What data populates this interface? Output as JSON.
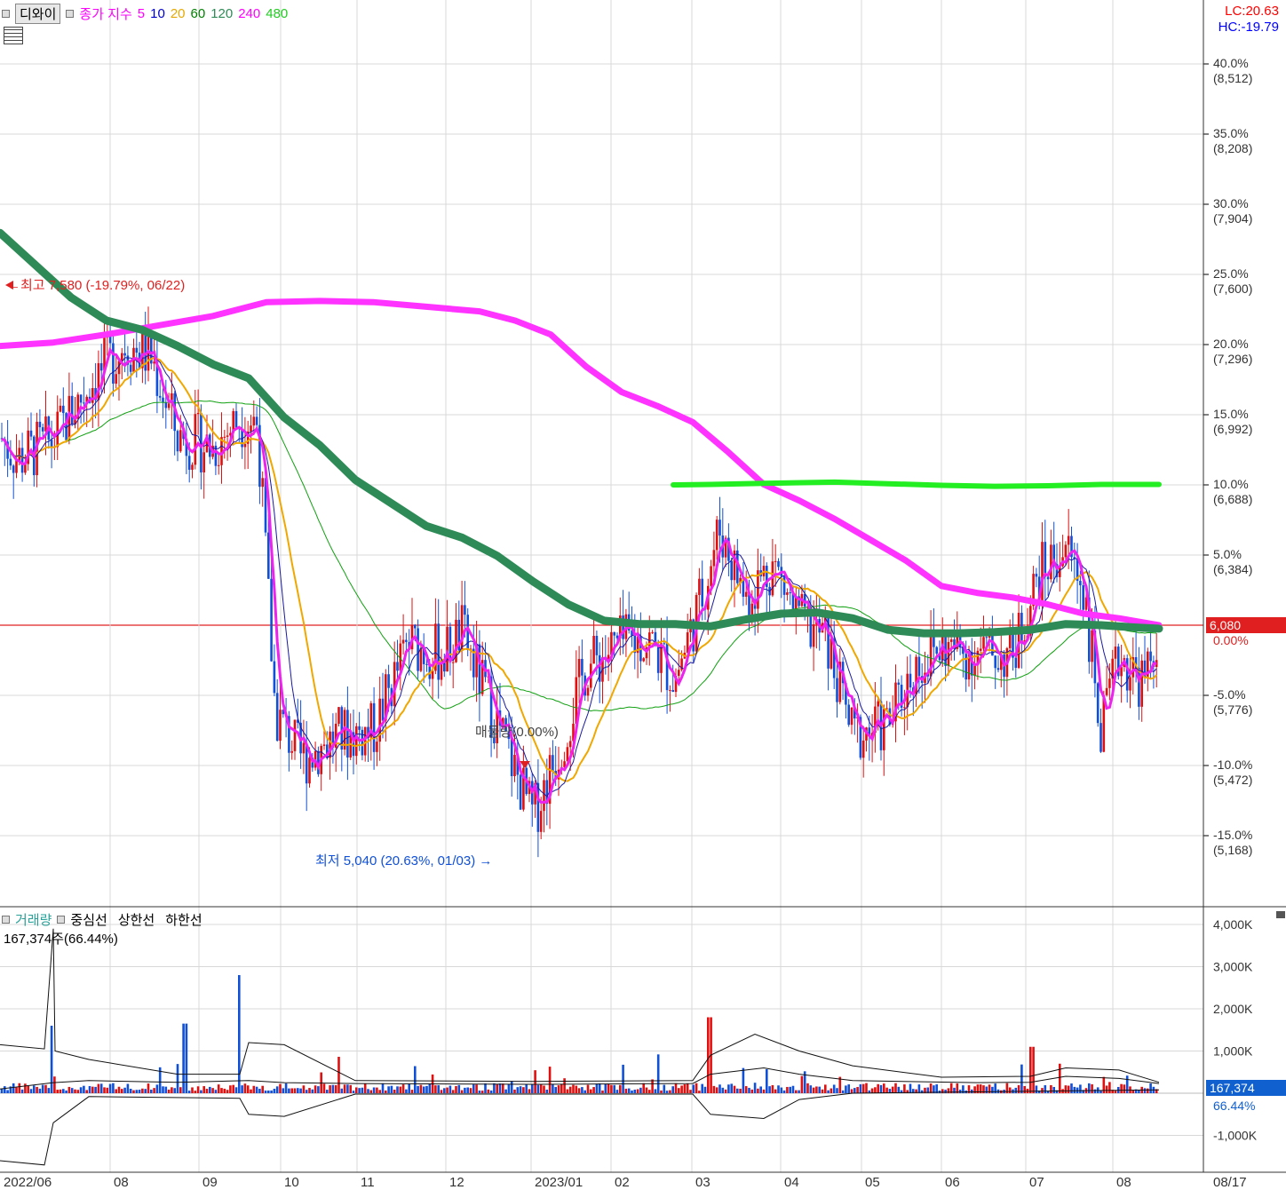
{
  "chart_data": [
    {
      "type": "line",
      "symbol": "디와이",
      "legend": {
        "title": "종가 지수",
        "periods": [
          {
            "label": "5",
            "color": "#ff00ff"
          },
          {
            "label": "10",
            "color": "#0000cc"
          },
          {
            "label": "20",
            "color": "#e6a800"
          },
          {
            "label": "60",
            "color": "#008000"
          },
          {
            "label": "120",
            "color": "#2e8b57"
          },
          {
            "label": "240",
            "color": "#ff00ff"
          },
          {
            "label": "480",
            "color": "#22cc22"
          }
        ]
      },
      "lc_label": "LC:20.63",
      "hc_label": "HC:-19.79",
      "current_price": 6080,
      "current_price_label": "6,080",
      "current_pct_label": "0.00%",
      "y_ticks": [
        {
          "pct": "40.0%",
          "price": "(8,512)",
          "value": 8512
        },
        {
          "pct": "35.0%",
          "price": "(8,208)",
          "value": 8208
        },
        {
          "pct": "30.0%",
          "price": "(7,904)",
          "value": 7904
        },
        {
          "pct": "25.0%",
          "price": "(7,600)",
          "value": 7600
        },
        {
          "pct": "20.0%",
          "price": "(7,296)",
          "value": 7296
        },
        {
          "pct": "15.0%",
          "price": "(6,992)",
          "value": 6992
        },
        {
          "pct": "10.0%",
          "price": "(6,688)",
          "value": 6688
        },
        {
          "pct": "5.0%",
          "price": "(6,384)",
          "value": 6384
        },
        {
          "pct": "-5.0%",
          "price": "(5,776)",
          "value": 5776
        },
        {
          "pct": "-10.0%",
          "price": "(5,472)",
          "value": 5472
        },
        {
          "pct": "-15.0%",
          "price": "(5,168)",
          "value": 5168
        }
      ],
      "annotations": [
        {
          "text": "최고 7,580 (-19.79%, 06/22)",
          "value": 7580
        },
        {
          "text": "최저 5,040 (20.63%, 01/03)",
          "value": 5040
        },
        {
          "text": "매물량(0.00%)"
        }
      ],
      "ma_series": [
        {
          "name": "240",
          "color": "#ff33ff",
          "points": [
            [
              0,
              7290
            ],
            [
              60,
              7305
            ],
            [
              120,
              7340
            ],
            [
              180,
              7380
            ],
            [
              240,
              7420
            ],
            [
              300,
              7480
            ],
            [
              360,
              7485
            ],
            [
              420,
              7480
            ],
            [
              480,
              7460
            ],
            [
              540,
              7440
            ],
            [
              580,
              7400
            ],
            [
              620,
              7340
            ],
            [
              660,
              7200
            ],
            [
              700,
              7090
            ],
            [
              740,
              7030
            ],
            [
              780,
              6960
            ],
            [
              820,
              6830
            ],
            [
              860,
              6690
            ],
            [
              900,
              6620
            ],
            [
              940,
              6540
            ],
            [
              980,
              6450
            ],
            [
              1020,
              6360
            ],
            [
              1060,
              6250
            ],
            [
              1100,
              6220
            ],
            [
              1140,
              6200
            ],
            [
              1180,
              6170
            ],
            [
              1220,
              6130
            ],
            [
              1260,
              6110
            ],
            [
              1305,
              6080
            ]
          ]
        },
        {
          "name": "120",
          "color": "#2e8b57",
          "points": [
            [
              0,
              7780
            ],
            [
              40,
              7640
            ],
            [
              80,
              7500
            ],
            [
              120,
              7400
            ],
            [
              160,
              7360
            ],
            [
              200,
              7290
            ],
            [
              240,
              7210
            ],
            [
              280,
              7150
            ],
            [
              320,
              6980
            ],
            [
              360,
              6860
            ],
            [
              400,
              6710
            ],
            [
              440,
              6610
            ],
            [
              480,
              6510
            ],
            [
              520,
              6460
            ],
            [
              560,
              6380
            ],
            [
              600,
              6270
            ],
            [
              640,
              6170
            ],
            [
              680,
              6100
            ],
            [
              720,
              6085
            ],
            [
              760,
              6085
            ],
            [
              800,
              6075
            ],
            [
              840,
              6105
            ],
            [
              880,
              6130
            ],
            [
              920,
              6135
            ],
            [
              960,
              6110
            ],
            [
              1000,
              6060
            ],
            [
              1040,
              6045
            ],
            [
              1080,
              6045
            ],
            [
              1120,
              6050
            ],
            [
              1160,
              6060
            ],
            [
              1200,
              6085
            ],
            [
              1240,
              6080
            ],
            [
              1280,
              6070
            ],
            [
              1305,
              6065
            ]
          ]
        },
        {
          "name": "480",
          "color": "#22ee22",
          "points": [
            [
              758,
              6688
            ],
            [
              800,
              6690
            ],
            [
              860,
              6695
            ],
            [
              940,
              6700
            ],
            [
              1000,
              6693
            ],
            [
              1060,
              6686
            ],
            [
              1120,
              6682
            ],
            [
              1180,
              6684
            ],
            [
              1240,
              6690
            ],
            [
              1305,
              6690
            ]
          ]
        }
      ],
      "time_labels": [
        "2022/06",
        "08",
        "09",
        "10",
        "11",
        "12",
        "2023/01",
        "02",
        "03",
        "04",
        "05",
        "06",
        "07",
        "08"
      ],
      "date_label": "08/17"
    },
    {
      "type": "bar",
      "legend": {
        "title": "거래량",
        "items": [
          "중심선",
          "상한선",
          "하한선"
        ]
      },
      "value_label": "167,374주(66.44%)",
      "y_ticks": [
        "4,000K",
        "3,000K",
        "2,000K",
        "1,000K",
        "-1,000K"
      ],
      "current_volume_label": "167,374",
      "current_pct_label": "66.44%"
    }
  ]
}
